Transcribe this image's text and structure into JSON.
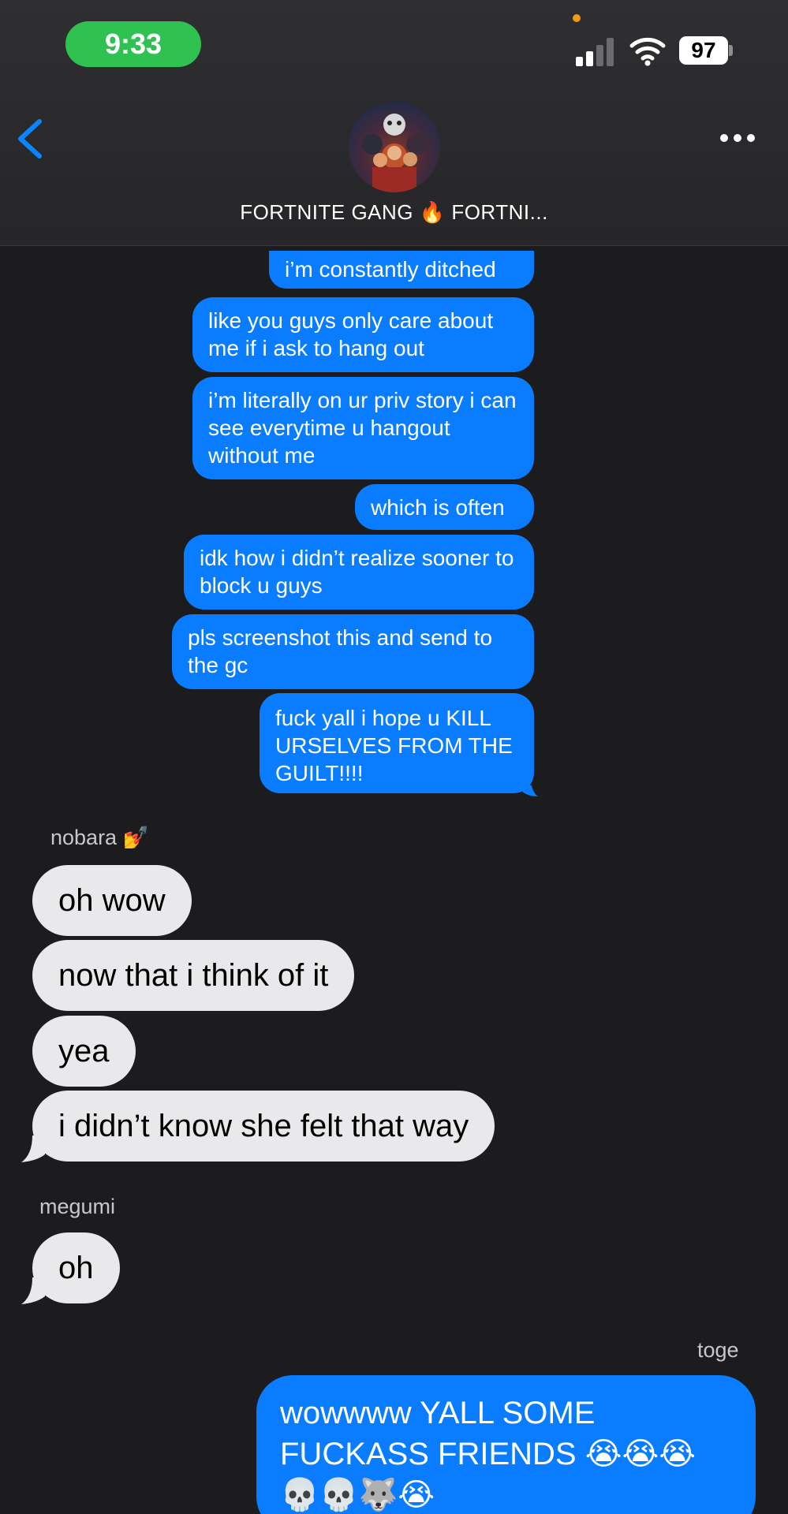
{
  "status_bar": {
    "time": "9:33",
    "battery": "97"
  },
  "header": {
    "group_name": "FORTNITE GANG 🔥 FORTNI..."
  },
  "outgoing_top": [
    "i’m constantly ditched",
    "like you guys only care about me if i ask to hang out",
    "i’m literally on ur priv story i can see everytime u hangout without me",
    "which is often",
    "idk how i didn’t realize sooner to block u guys",
    "pls screenshot this and send to the gc",
    "fuck yall i hope u KILL URSELVES FROM THE GUILT!!!!"
  ],
  "nobara": {
    "sender": "nobara 💅",
    "messages": [
      "oh wow",
      "now that i think of it",
      "yea",
      "i didn’t know she felt that way"
    ]
  },
  "megumi": {
    "sender": "megumi",
    "messages": [
      "oh"
    ]
  },
  "toge": {
    "sender": "toge",
    "messages": [
      "wowwww YALL SOME FUCKASS FRIENDS 😭😭😭 💀💀🐺😭"
    ]
  },
  "colors": {
    "outgoing": "#0a7cff",
    "incoming": "#e9e9eb",
    "background": "#1c1c1e",
    "time_pill": "#30c251"
  }
}
